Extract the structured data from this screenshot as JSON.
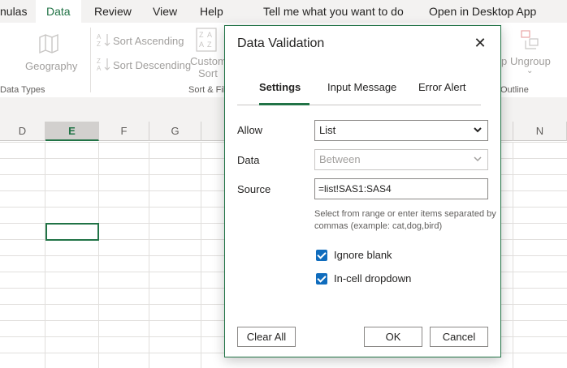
{
  "menubar": {
    "items": [
      {
        "label": "nulas"
      },
      {
        "label": "Data"
      },
      {
        "label": "Review"
      },
      {
        "label": "View"
      },
      {
        "label": "Help"
      },
      {
        "label": "Tell me what you want to do"
      },
      {
        "label": "Open in Desktop App"
      }
    ]
  },
  "ribbon": {
    "geography": "Geography",
    "data_types_group": "Data Types",
    "sort_ascending": "Sort Ascending",
    "sort_descending": "Sort Descending",
    "custom": "Custom",
    "sort": "Sort",
    "sort_filter_group": "Sort & Fil",
    "ungroup": "Ungroup",
    "ungroup_left": "p",
    "outline_group": "Outline",
    "expand_glyph": "⌄"
  },
  "sheet": {
    "columns": [
      "D",
      "E",
      "F",
      "G",
      "N"
    ],
    "selected_column": "E"
  },
  "dialog": {
    "title": "Data Validation",
    "close_glyph": "✕",
    "tabs": [
      {
        "label": "Settings"
      },
      {
        "label": "Input Message"
      },
      {
        "label": "Error Alert"
      }
    ],
    "allow_label": "Allow",
    "allow_value": "List",
    "data_label": "Data",
    "data_value": "Between",
    "source_label": "Source",
    "source_value": "=list!SAS1:SAS4",
    "hint": "Select from range or enter items separated by commas (example: cat,dog,bird)",
    "ignore_blank": "Ignore blank",
    "in_cell_dropdown": "In-cell dropdown",
    "clear_all": "Clear All",
    "ok": "OK",
    "cancel": "Cancel"
  },
  "colors": {
    "accent": "#217346",
    "checkbox": "#0f6cbd"
  }
}
